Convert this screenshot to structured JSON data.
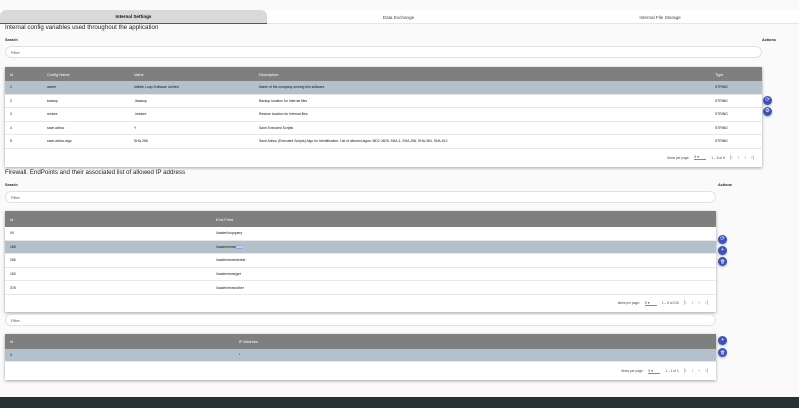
{
  "tabs": [
    {
      "label": "Internal Settings",
      "active": true
    },
    {
      "label": "Data Exchange",
      "active": false
    },
    {
      "label": "Internal File Storage",
      "active": false
    }
  ],
  "config_section": {
    "title": "Internal config variables used throughout the application",
    "search_label": "Search",
    "actions_label": "Actions",
    "filter_placeholder": "Filter",
    "columns": [
      "Id",
      "Config Name",
      "Value",
      "Description",
      "Type"
    ],
    "rows": [
      {
        "id": "1",
        "name": "owner",
        "value": "Infinite Loop Software Limited",
        "description": "Name of the company running this software",
        "type": "STRING",
        "selected": true
      },
      {
        "id": "2",
        "name": "backup",
        "value": "./backup",
        "description": "Backup location for Internal files",
        "type": "STRING",
        "selected": false
      },
      {
        "id": "3",
        "name": "restore",
        "value": "./restore",
        "description": "Restore location for Internal files",
        "type": "STRING",
        "selected": false
      },
      {
        "id": "4",
        "name": "save.adhoc",
        "value": "Y",
        "description": "Save Executed Scripts",
        "type": "STRING",
        "selected": false
      },
      {
        "id": "5",
        "name": "save.adhoc.algo",
        "value": "SHA-256",
        "description": "Save Adhoc (Executed Scripts) Algo for Identification. List of allowed algos: MD2, MD5, SHA-1, SHA-256, SHA-384, SHA-512",
        "type": "STRING",
        "selected": false
      }
    ],
    "pager": {
      "label": "Items per page:",
      "size": "5",
      "range": "1 – 5 of 6"
    }
  },
  "firewall_section": {
    "title": "Firewall. EndPoints and their associated list of allowed IP address",
    "search_label": "Search",
    "actions_label": "Actions",
    "filter_placeholder": "Filter",
    "columns": [
      "Id",
      "End-Point"
    ],
    "rows": [
      {
        "id": "94",
        "endpoint_pre": "/loader/loopquery",
        "endpoint_hl": "",
        "selected": false
      },
      {
        "id": "168",
        "endpoint_pre": "/loader/news/",
        "endpoint_hl": "data",
        "selected": true
      },
      {
        "id": "256",
        "endpoint_pre": "/loader/news/delete",
        "endpoint_hl": "",
        "selected": false
      },
      {
        "id": "183",
        "endpoint_pre": "/loader/news/get",
        "endpoint_hl": "",
        "selected": false
      },
      {
        "id": "378",
        "endpoint_pre": "/loader/news/other",
        "endpoint_hl": "",
        "selected": false
      }
    ],
    "pager": {
      "label": "Items per page:",
      "size": "5",
      "range": "1 – 5 of 215"
    }
  },
  "ip_section": {
    "filter_placeholder": "Filter",
    "columns": [
      "Id",
      "IP Address"
    ],
    "rows": [
      {
        "id": "3",
        "ip": "*",
        "selected": true
      }
    ],
    "pager": {
      "label": "Items per page:",
      "size": "5",
      "range": "1 – 1 of 1"
    }
  },
  "icons": {
    "refresh": "⟳",
    "add": "+",
    "delete": "🗑",
    "settings": "⚙",
    "dropdown": "▾",
    "first": "|‹",
    "prev": "‹",
    "next": "›",
    "last": "›|"
  },
  "colors": {
    "accent": "#3f51b5",
    "header_gray": "#7f7f7f",
    "selected_row": "#b4c1cb",
    "footer": "#263238"
  },
  "footer": {
    "text": ""
  }
}
